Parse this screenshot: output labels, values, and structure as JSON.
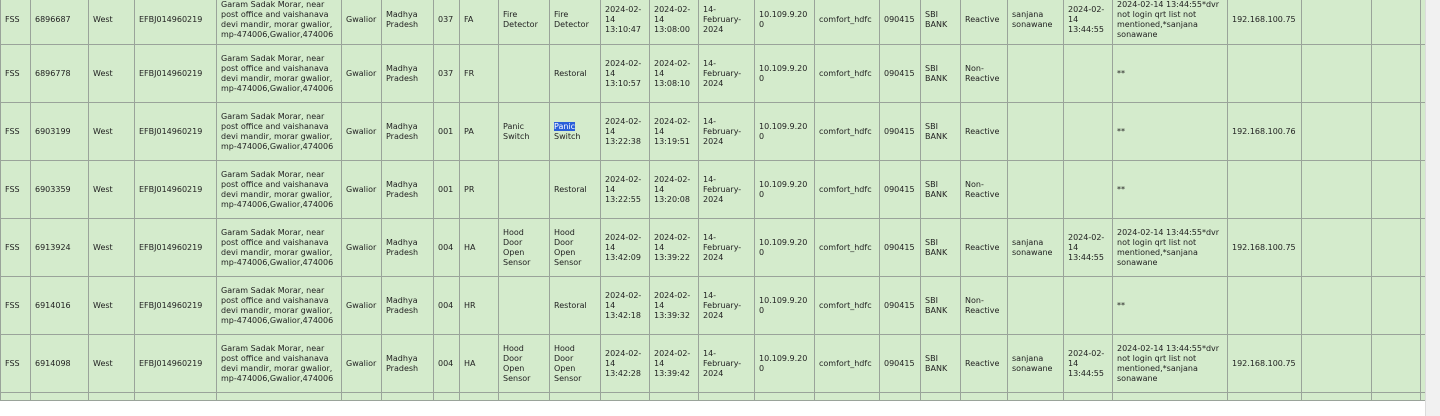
{
  "rows": [
    {
      "type": "FSS",
      "id": "6896687",
      "zone": "West",
      "atm_id": "EFBJ014960219",
      "address": "Garam Sadak Morar, near post office and vaishanava devi mandir, morar gwalior, mp-474006,Gwalior,474006",
      "city": "Gwalior",
      "state": "Madhya Pradesh",
      "zone_no": "037",
      "code": "FA",
      "alert": "Fire Detector",
      "description": "Fire Detector",
      "alert_time": "2024-02-14 13:10:47",
      "panel_time": "2024-02-14 13:08:00",
      "date": "14-February-2024",
      "ip": "10.109.9.200",
      "site": "comfort_hdfc",
      "pin": "090415",
      "bank": "SBI BANK",
      "status": "Reactive",
      "operator": "sanjana sonawane",
      "closed_time": "2024-02-14 13:44:55",
      "remarks": "2024-02-14 13:44:55*dvr not login qrt list not mentioned,*sanjana sonawane",
      "dvr_ip": "192.168.100.75"
    },
    {
      "type": "FSS",
      "id": "6896778",
      "zone": "West",
      "atm_id": "EFBJ014960219",
      "address": "Garam Sadak Morar, near post office and vaishanava devi mandir, morar gwalior, mp-474006,Gwalior,474006",
      "city": "Gwalior",
      "state": "Madhya Pradesh",
      "zone_no": "037",
      "code": "FR",
      "alert": "",
      "description": "Restoral",
      "alert_time": "2024-02-14 13:10:57",
      "panel_time": "2024-02-14 13:08:10",
      "date": "14-February-2024",
      "ip": "10.109.9.200",
      "site": "comfort_hdfc",
      "pin": "090415",
      "bank": "SBI BANK",
      "status": "Non-Reactive",
      "operator": "",
      "closed_time": "",
      "remarks": "**",
      "dvr_ip": ""
    },
    {
      "type": "FSS",
      "id": "6903199",
      "zone": "West",
      "atm_id": "EFBJ014960219",
      "address": "Garam Sadak Morar, near post office and vaishanava devi mandir, morar gwalior, mp-474006,Gwalior,474006",
      "city": "Gwalior",
      "state": "Madhya Pradesh",
      "zone_no": "001",
      "code": "PA",
      "alert": "Panic Switch",
      "description": "Panic Switch",
      "alert_time": "2024-02-14 13:22:38",
      "panel_time": "2024-02-14 13:19:51",
      "date": "14-February-2024",
      "ip": "10.109.9.200",
      "site": "comfort_hdfc",
      "pin": "090415",
      "bank": "SBI BANK",
      "status": "Reactive",
      "operator": "",
      "closed_time": "",
      "remarks": "**",
      "dvr_ip": "192.168.100.76"
    },
    {
      "type": "FSS",
      "id": "6903359",
      "zone": "West",
      "atm_id": "EFBJ014960219",
      "address": "Garam Sadak Morar, near post office and vaishanava devi mandir, morar gwalior, mp-474006,Gwalior,474006",
      "city": "Gwalior",
      "state": "Madhya Pradesh",
      "zone_no": "001",
      "code": "PR",
      "alert": "",
      "description": "Restoral",
      "alert_time": "2024-02-14 13:22:55",
      "panel_time": "2024-02-14 13:20:08",
      "date": "14-February-2024",
      "ip": "10.109.9.200",
      "site": "comfort_hdfc",
      "pin": "090415",
      "bank": "SBI BANK",
      "status": "Non-Reactive",
      "operator": "",
      "closed_time": "",
      "remarks": "**",
      "dvr_ip": ""
    },
    {
      "type": "FSS",
      "id": "6913924",
      "zone": "West",
      "atm_id": "EFBJ014960219",
      "address": "Garam Sadak Morar, near post office and vaishanava devi mandir, morar gwalior, mp-474006,Gwalior,474006",
      "city": "Gwalior",
      "state": "Madhya Pradesh",
      "zone_no": "004",
      "code": "HA",
      "alert": "Hood Door Open Sensor",
      "description": "Hood Door Open Sensor",
      "alert_time": "2024-02-14 13:42:09",
      "panel_time": "2024-02-14 13:39:22",
      "date": "14-February-2024",
      "ip": "10.109.9.200",
      "site": "comfort_hdfc",
      "pin": "090415",
      "bank": "SBI BANK",
      "status": "Reactive",
      "operator": "sanjana sonawane",
      "closed_time": "2024-02-14 13:44:55",
      "remarks": "2024-02-14 13:44:55*dvr not login qrt list not mentioned,*sanjana sonawane",
      "dvr_ip": "192.168.100.75"
    },
    {
      "type": "FSS",
      "id": "6914016",
      "zone": "West",
      "atm_id": "EFBJ014960219",
      "address": "Garam Sadak Morar, near post office and vaishanava devi mandir, morar gwalior, mp-474006,Gwalior,474006",
      "city": "Gwalior",
      "state": "Madhya Pradesh",
      "zone_no": "004",
      "code": "HR",
      "alert": "",
      "description": "Restoral",
      "alert_time": "2024-02-14 13:42:18",
      "panel_time": "2024-02-14 13:39:32",
      "date": "14-February-2024",
      "ip": "10.109.9.200",
      "site": "comfort_hdfc",
      "pin": "090415",
      "bank": "SBI BANK",
      "status": "Non-Reactive",
      "operator": "",
      "closed_time": "",
      "remarks": "**",
      "dvr_ip": ""
    },
    {
      "type": "FSS",
      "id": "6914098",
      "zone": "West",
      "atm_id": "EFBJ014960219",
      "address": "Garam Sadak Morar, near post office and vaishanava devi mandir, morar gwalior, mp-474006,Gwalior,474006",
      "city": "Gwalior",
      "state": "Madhya Pradesh",
      "zone_no": "004",
      "code": "HA",
      "alert": "Hood Door Open Sensor",
      "description": "Hood Door Open Sensor",
      "alert_time": "2024-02-14 13:42:28",
      "panel_time": "2024-02-14 13:39:42",
      "date": "14-February-2024",
      "ip": "10.109.9.200",
      "site": "comfort_hdfc",
      "pin": "090415",
      "bank": "SBI BANK",
      "status": "Reactive",
      "operator": "sanjana sonawane",
      "closed_time": "2024-02-14 13:44:55",
      "remarks": "2024-02-14 13:44:55*dvr not login qrt list not mentioned,*sanjana sonawane",
      "dvr_ip": "192.168.100.75"
    }
  ],
  "selection": {
    "row": 2,
    "field": "description",
    "text": "Panic"
  },
  "colors": {
    "row_bg": "#d4ebcc",
    "border": "#9aa39a",
    "selection": "#2b5fd9"
  }
}
